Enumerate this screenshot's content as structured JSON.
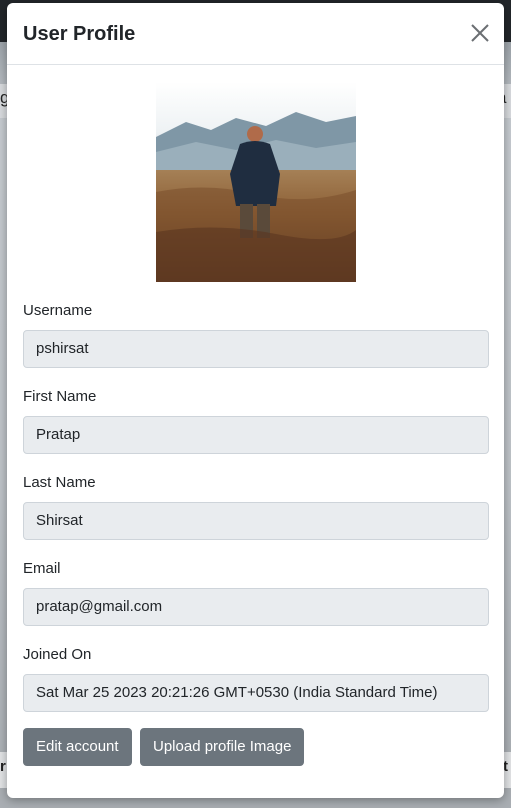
{
  "backdrop": {
    "edge_left_text": "g",
    "edge_right_text": "a",
    "edge_left_bottom_text": "r",
    "edge_right_bottom_text": "t"
  },
  "modal": {
    "title": "User Profile",
    "close_icon": "close-icon"
  },
  "profile": {
    "image": "profile-photo",
    "fields": [
      {
        "label": "Username",
        "value": "pshirsat"
      },
      {
        "label": "First Name",
        "value": "Pratap"
      },
      {
        "label": "Last Name",
        "value": "Shirsat"
      },
      {
        "label": "Email",
        "value": "pratap@gmail.com"
      },
      {
        "label": "Joined On",
        "value": "Sat Mar 25 2023 20:21:26 GMT+0530 (India Standard Time)"
      }
    ]
  },
  "actions": {
    "edit_label": "Edit account",
    "upload_label": "Upload profile Image"
  },
  "colors": {
    "button_bg": "#6c757d",
    "input_bg": "#e9ecef",
    "border": "#ced4da"
  }
}
